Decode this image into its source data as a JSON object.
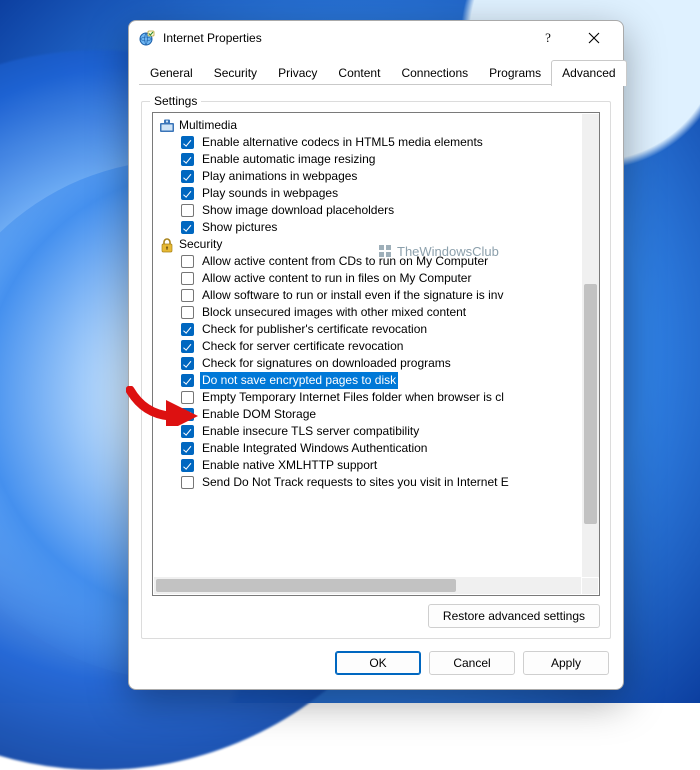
{
  "window": {
    "title": "Internet Properties"
  },
  "tabs": [
    "General",
    "Security",
    "Privacy",
    "Content",
    "Connections",
    "Programs",
    "Advanced"
  ],
  "active_tab": "Advanced",
  "settings_label": "Settings",
  "watermark": "TheWindowsClub",
  "groups": [
    {
      "icon": "multimedia",
      "label": "Multimedia",
      "items": [
        {
          "checked": true,
          "label": "Enable alternative codecs in HTML5 media elements"
        },
        {
          "checked": true,
          "label": "Enable automatic image resizing"
        },
        {
          "checked": true,
          "label": "Play animations in webpages"
        },
        {
          "checked": true,
          "label": "Play sounds in webpages"
        },
        {
          "checked": false,
          "label": "Show image download placeholders"
        },
        {
          "checked": true,
          "label": "Show pictures"
        }
      ]
    },
    {
      "icon": "security",
      "label": "Security",
      "items": [
        {
          "checked": false,
          "label": "Allow active content from CDs to run on My Computer"
        },
        {
          "checked": false,
          "label": "Allow active content to run in files on My Computer"
        },
        {
          "checked": false,
          "label": "Allow software to run or install even if the signature is inv"
        },
        {
          "checked": false,
          "label": "Block unsecured images with other mixed content"
        },
        {
          "checked": true,
          "label": "Check for publisher's certificate revocation"
        },
        {
          "checked": true,
          "label": "Check for server certificate revocation"
        },
        {
          "checked": true,
          "label": "Check for signatures on downloaded programs"
        },
        {
          "checked": true,
          "label": "Do not save encrypted pages to disk",
          "selected": true
        },
        {
          "checked": false,
          "label": "Empty Temporary Internet Files folder when browser is cl"
        },
        {
          "checked": true,
          "label": "Enable DOM Storage"
        },
        {
          "checked": true,
          "label": "Enable insecure TLS server compatibility"
        },
        {
          "checked": true,
          "label": "Enable Integrated Windows Authentication"
        },
        {
          "checked": true,
          "label": "Enable native XMLHTTP support"
        },
        {
          "checked": false,
          "label": "Send Do Not Track requests to sites you visit in Internet E"
        }
      ]
    }
  ],
  "buttons": {
    "restore": "Restore advanced settings",
    "ok": "OK",
    "cancel": "Cancel",
    "apply": "Apply"
  }
}
